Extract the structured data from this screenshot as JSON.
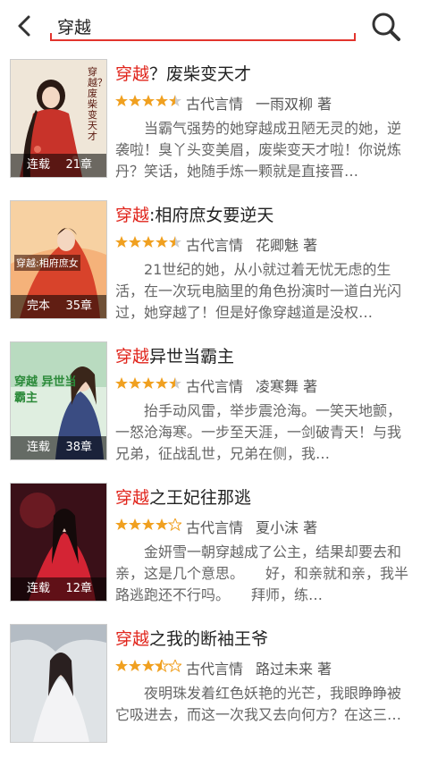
{
  "search": {
    "query": "穿越"
  },
  "icons": {
    "back": "chevron-left-icon",
    "search": "search-icon"
  },
  "colors": {
    "accent": "#e2342d",
    "highlight": "#e0241b",
    "star": "#f0a020"
  },
  "books": [
    {
      "title_highlight": "穿越",
      "title_rest": "？废柴变天才",
      "stars": 4.5,
      "genre": "古代言情",
      "author": "一雨双柳 著",
      "status": "连载",
      "chapters": "21章",
      "desc": "当霸气强势的她穿越成丑陋无灵的她，逆袭啦！臭丫头变美眉，废柴变天才啦！你说炼丹？笑话，她随手炼一颗就是直接晋…",
      "cover_text": "穿越？废柴变天才"
    },
    {
      "title_highlight": "穿越",
      "title_rest": ":相府庶女要逆天",
      "stars": 4.5,
      "genre": "古代言情",
      "author": "花卿魅 著",
      "status": "完本",
      "chapters": "35章",
      "desc": "21世纪的她，从小就过着无忧无虑的生活，在一次玩电脑里的角色扮演时一道白光闪过，她穿越了！但是好像穿越道是没权…",
      "cover_text": "穿越:相府庶女"
    },
    {
      "title_highlight": "穿越",
      "title_rest": "异世当霸主",
      "stars": 4.5,
      "genre": "古代言情",
      "author": "凌寒舞 著",
      "status": "连载",
      "chapters": "38章",
      "desc": "抬手动风雷，举步震沧海。一笑天地颤，一怒沧海寒。一步至天涯，一剑破青天！与我兄弟，征战乱世，兄弟在侧，我…",
      "cover_text": "穿越 异世当霸主"
    },
    {
      "title_highlight": "穿越",
      "title_rest": "之王妃往那逃",
      "stars": 4,
      "genre": "古代言情",
      "author": "夏小沫 著",
      "status": "连载",
      "chapters": "12章",
      "desc": "金妍雪一朝穿越成了公主，结果却要去和亲，这是几个意思。　　好，和亲就和亲，我半路逃跑还不行吗。　　拜师，练…",
      "cover_text": ""
    },
    {
      "title_highlight": "穿越",
      "title_rest": "之我的断袖王爷",
      "stars": 3.5,
      "genre": "古代言情",
      "author": "路过未来 著",
      "status": "",
      "chapters": "",
      "desc": "夜明珠发着红色妖艳的光芒，我眼睁睁被它吸进去，而这一次我又去向何方？在这三…",
      "cover_text": ""
    }
  ]
}
